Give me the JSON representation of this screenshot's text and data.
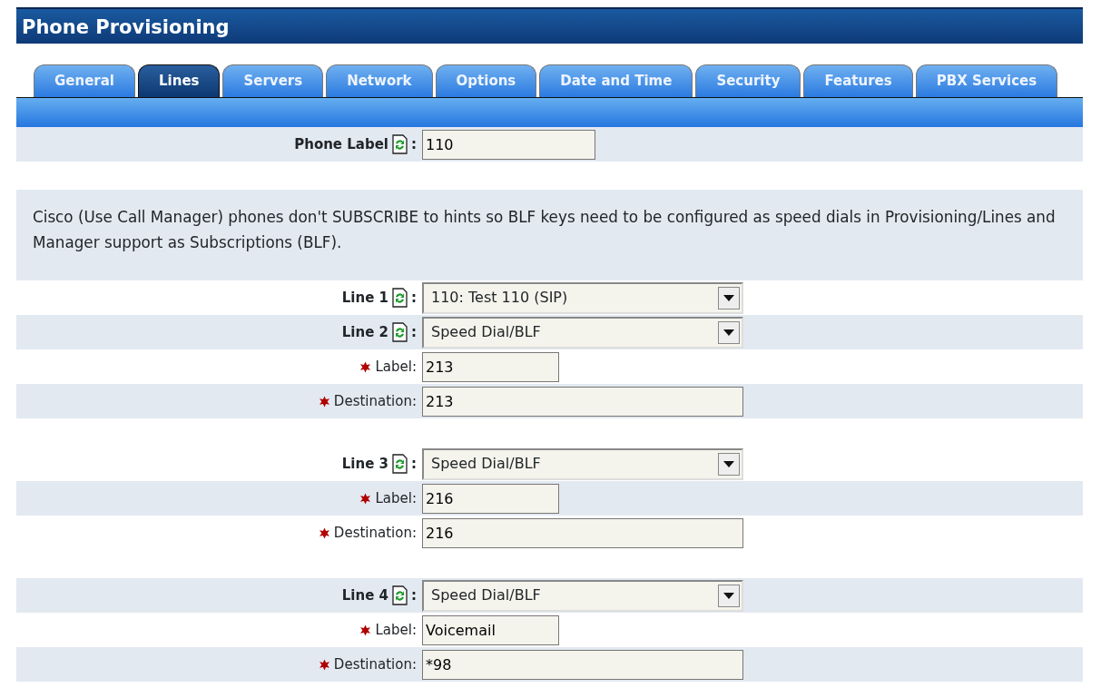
{
  "title": "Phone Provisioning",
  "tabs": [
    {
      "label": "General",
      "selected": false
    },
    {
      "label": "Lines",
      "selected": true
    },
    {
      "label": "Servers",
      "selected": false
    },
    {
      "label": "Network",
      "selected": false
    },
    {
      "label": "Options",
      "selected": false
    },
    {
      "label": "Date and Time",
      "selected": false
    },
    {
      "label": "Security",
      "selected": false
    },
    {
      "label": "Features",
      "selected": false
    },
    {
      "label": "PBX Services",
      "selected": false
    }
  ],
  "phone_label": {
    "label": "Phone Label",
    "colon": ":",
    "value": "110"
  },
  "note": [
    "Cisco (Use Call Manager) phones don't SUBSCRIBE to hints so BLF keys need to be configured as speed dials in Provisioning/Lines and",
    "Manager support as Subscriptions (BLF)."
  ],
  "lines": [
    {
      "label": "Line 1",
      "colon": ":",
      "value": "110: Test 110 (SIP)"
    },
    {
      "label": "Line 2",
      "colon": ":",
      "value": "Speed Dial/BLF",
      "fields": [
        {
          "label": "Label:",
          "required": true,
          "kind": "short",
          "value": "213"
        },
        {
          "label": "Destination:",
          "required": true,
          "kind": "long",
          "value": "213"
        }
      ]
    },
    {
      "label": "Line 3",
      "colon": ":",
      "value": "Speed Dial/BLF",
      "fields": [
        {
          "label": "Label:",
          "required": true,
          "kind": "short",
          "value": "216"
        },
        {
          "label": "Destination:",
          "required": true,
          "kind": "long",
          "value": "216"
        }
      ]
    },
    {
      "label": "Line 4",
      "colon": ":",
      "value": "Speed Dial/BLF",
      "fields": [
        {
          "label": "Label:",
          "required": true,
          "kind": "short",
          "value": "Voicemail"
        },
        {
          "label": "Destination:",
          "required": true,
          "kind": "long",
          "value": "*98"
        }
      ]
    }
  ]
}
